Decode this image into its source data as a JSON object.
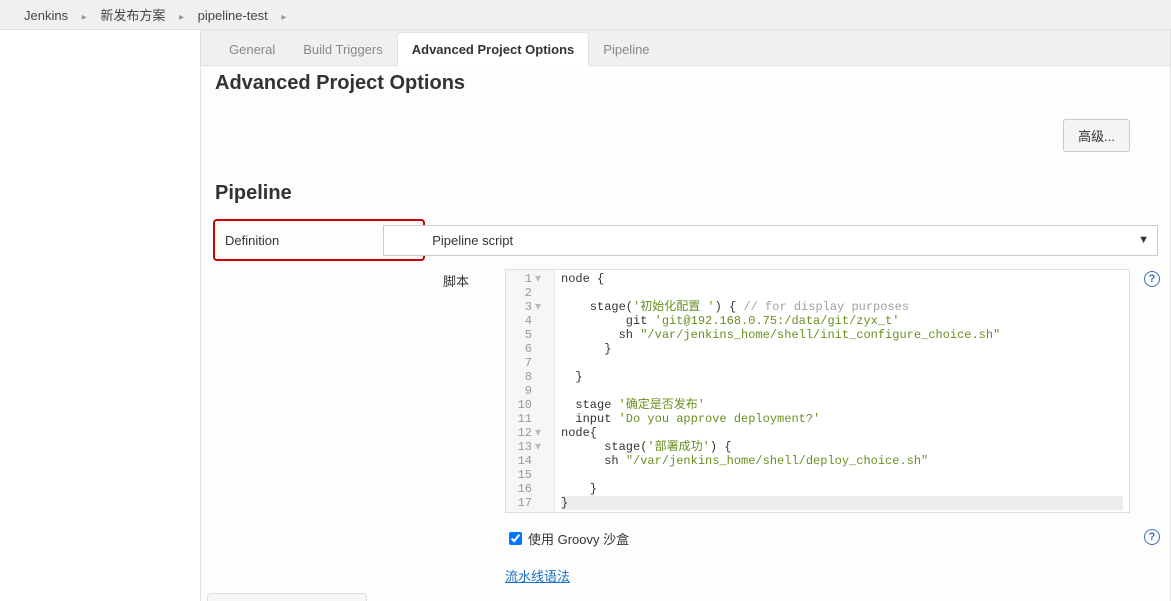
{
  "breadcrumb": {
    "items": [
      "Jenkins",
      "新发布方案",
      "pipeline-test"
    ]
  },
  "tabs": {
    "general": "General",
    "build_triggers": "Build Triggers",
    "advanced": "Advanced Project Options",
    "pipeline": "Pipeline",
    "active_index": 2
  },
  "section": {
    "advanced_heading": "Advanced Project Options",
    "advanced_btn": "高级...",
    "pipeline_heading": "Pipeline"
  },
  "definition": {
    "label": "Definition",
    "selected": "Pipeline script"
  },
  "script": {
    "label": "脚本",
    "lines": [
      {
        "n": 1,
        "fold": true,
        "text": "node {"
      },
      {
        "n": 2,
        "fold": false,
        "text": ""
      },
      {
        "n": 3,
        "fold": true,
        "text": "    stage('初始化配置 ') { // for display purposes"
      },
      {
        "n": 4,
        "fold": false,
        "text": "         git 'git@192.168.0.75:/data/git/zyx_t'"
      },
      {
        "n": 5,
        "fold": false,
        "text": "        sh \"/var/jenkins_home/shell/init_configure_choice.sh\""
      },
      {
        "n": 6,
        "fold": false,
        "text": "      }"
      },
      {
        "n": 7,
        "fold": false,
        "text": ""
      },
      {
        "n": 8,
        "fold": false,
        "text": "  }"
      },
      {
        "n": 9,
        "fold": false,
        "text": ""
      },
      {
        "n": 10,
        "fold": false,
        "text": "  stage '确定是否发布'"
      },
      {
        "n": 11,
        "fold": false,
        "text": "  input 'Do you approve deployment?'"
      },
      {
        "n": 12,
        "fold": true,
        "text": "node{"
      },
      {
        "n": 13,
        "fold": true,
        "text": "      stage('部署成功') {"
      },
      {
        "n": 14,
        "fold": false,
        "text": "      sh \"/var/jenkins_home/shell/deploy_choice.sh\""
      },
      {
        "n": 15,
        "fold": false,
        "text": ""
      },
      {
        "n": 16,
        "fold": false,
        "text": "    }"
      },
      {
        "n": 17,
        "fold": false,
        "text": "}"
      }
    ],
    "active_line": 17
  },
  "sandbox": {
    "checked": true,
    "label": "使用 Groovy 沙盒"
  },
  "syntax_link": "流水线语法",
  "help_glyph": "?"
}
